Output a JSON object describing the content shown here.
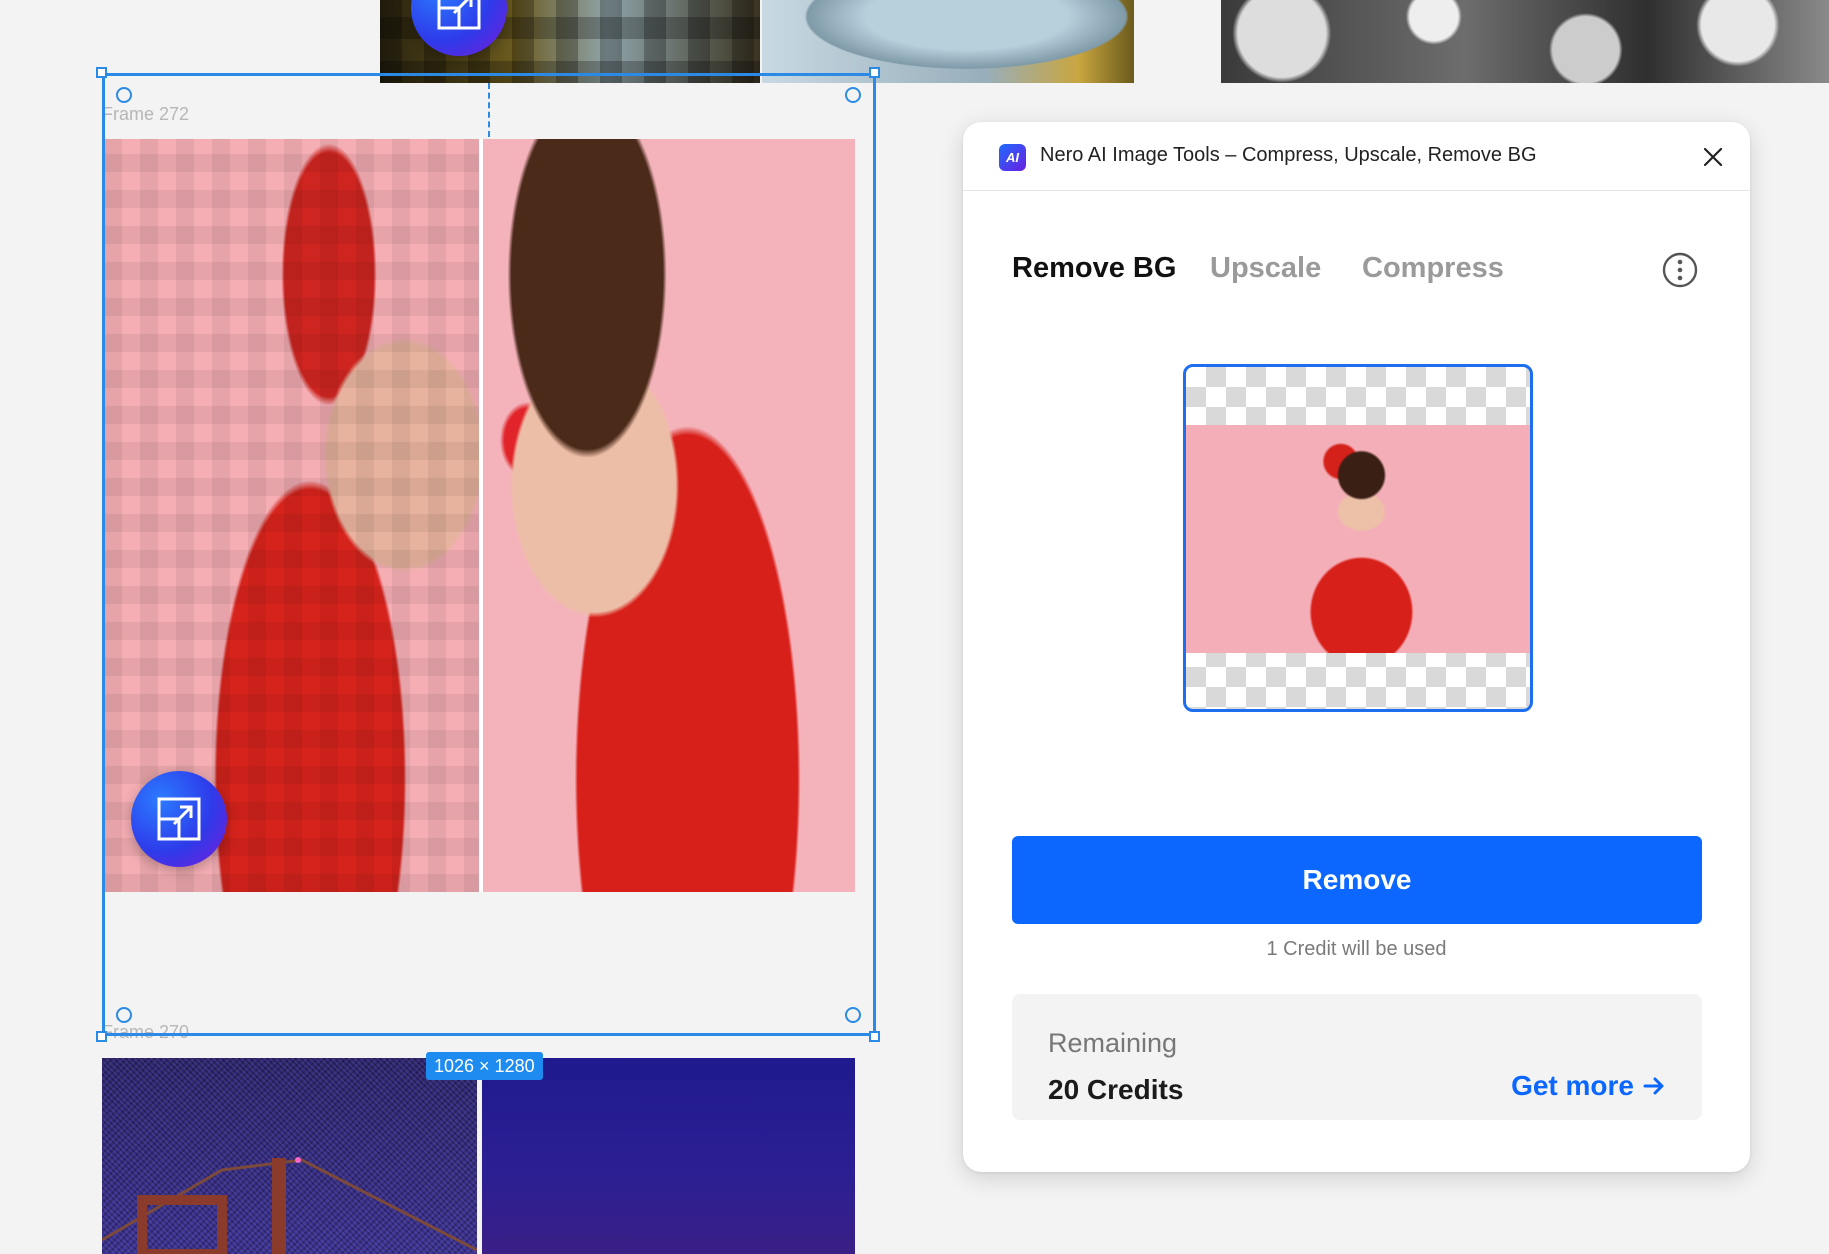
{
  "canvas": {
    "frame_top_label": "Frame 272",
    "frame_bottom_label": "Frame 270",
    "dimension_badge": "1026 × 1280"
  },
  "panel": {
    "title": "Nero AI Image Tools – Compress, Upscale, Remove BG",
    "logo_text": "AI",
    "tabs": [
      {
        "label": "Remove BG",
        "active": true
      },
      {
        "label": "Upscale",
        "active": false
      },
      {
        "label": "Compress",
        "active": false
      }
    ],
    "remove_label": "Remove",
    "credit_note": "1 Credit will be used",
    "remaining_label": "Remaining",
    "remaining_value": "20 Credits",
    "get_more_label": "Get more"
  },
  "colors": {
    "accent": "#0b67ff",
    "selection": "#2a8ae6",
    "logo_gradient_start": "#1f6bff",
    "logo_gradient_end": "#6b1fe0"
  },
  "icons": {
    "close": "close-icon",
    "info": "more-info-icon",
    "arrow": "arrow-right-icon",
    "fab": "open-external-icon"
  }
}
